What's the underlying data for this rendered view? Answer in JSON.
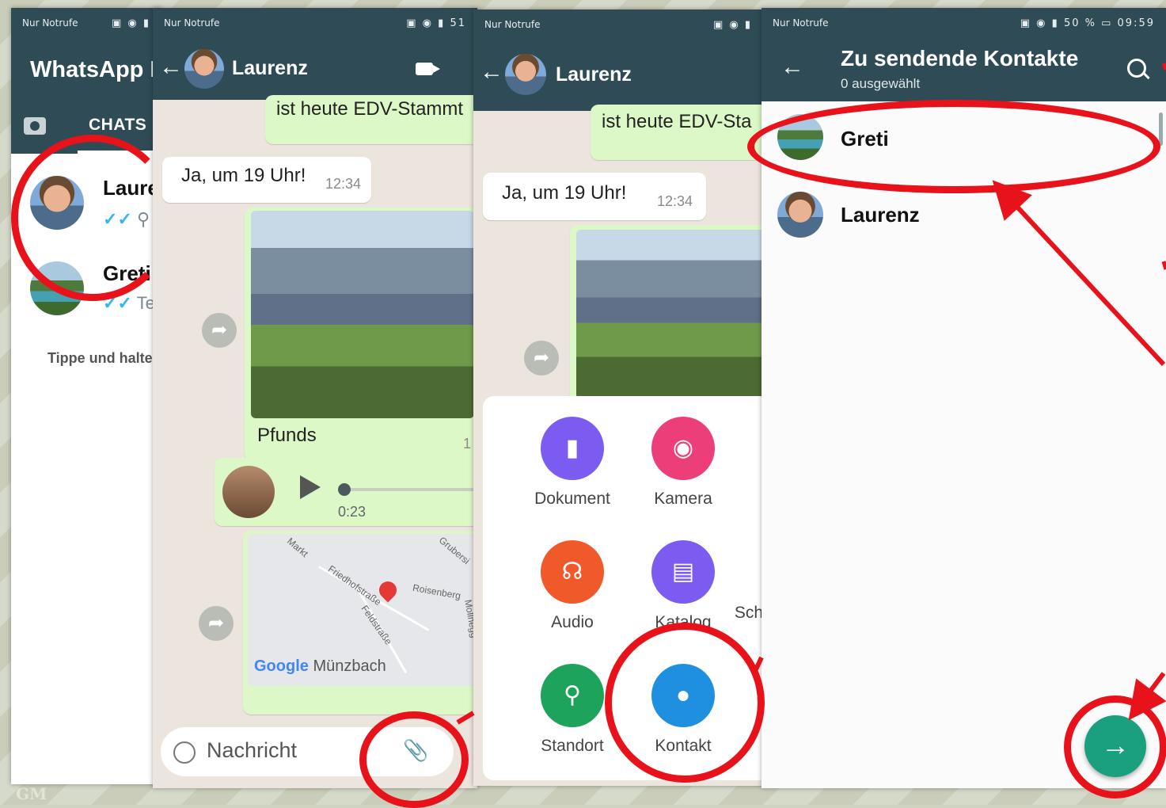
{
  "watermark": "GM",
  "status": {
    "carrier": "Nur Notrufe",
    "battery_pct": "50 %",
    "time": "09:59",
    "battery_short": "51"
  },
  "panel1": {
    "app_title": "WhatsApp B",
    "tab_chats": "CHATS",
    "chats": [
      {
        "name": "Laure",
        "preview": "S"
      },
      {
        "name": "Greti",
        "preview": "Tes"
      }
    ],
    "hint": "Tippe und halte"
  },
  "panel2": {
    "contact": "Laurenz",
    "top_msg": "ist heute EDV-Stammt",
    "msg1": "Ja, um 19 Uhr!",
    "msg1_time": "12:34",
    "photo_caption": "Pfunds",
    "voice_duration": "0:23",
    "time_stub": "1",
    "map_labels": [
      "Markt",
      "Friedhofstraße",
      "Feldstraße",
      "Roisenberg",
      "Grubersi",
      "Mollnegg",
      "Münzbach"
    ],
    "map_logo": "Google",
    "input_placeholder": "Nachricht"
  },
  "panel3": {
    "contact": "Laurenz",
    "top_msg": "ist heute EDV-Sta",
    "msg1": "Ja, um 19 Uhr!",
    "msg1_time": "12:34",
    "attachments": [
      {
        "label": "Dokument",
        "color": "#7c5cf0",
        "icon": "document-icon"
      },
      {
        "label": "Kamera",
        "color": "#ec3f7a",
        "icon": "camera-icon"
      },
      {
        "label": "Audio",
        "color": "#f05a2b",
        "icon": "headphones-icon"
      },
      {
        "label": "Katalog",
        "color": "#7c5cf0",
        "icon": "store-icon"
      },
      {
        "label": "Sch",
        "color": "#ffffff",
        "icon": "none"
      },
      {
        "label": "Standort",
        "color": "#1ea35a",
        "icon": "location-icon"
      },
      {
        "label": "Kontakt",
        "color": "#1f8fe0",
        "icon": "person-icon"
      }
    ]
  },
  "panel4": {
    "title": "Zu sendende Kontakte",
    "subtitle": "0 ausgewählt",
    "contacts": [
      {
        "name": "Greti"
      },
      {
        "name": "Laurenz"
      }
    ]
  },
  "colors": {
    "header": "#2f4b55",
    "annotation": "#e8121a",
    "fab": "#1aa07f",
    "bubble_out": "#dcf8c6"
  }
}
